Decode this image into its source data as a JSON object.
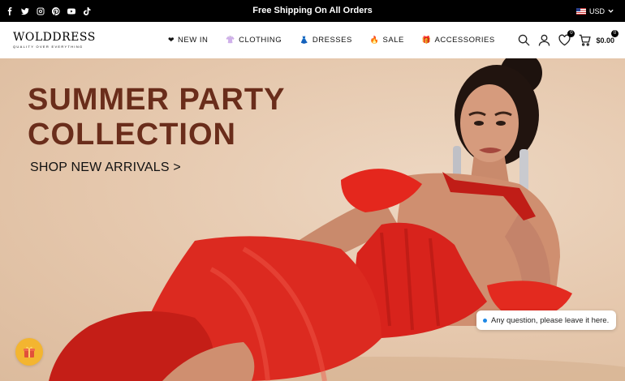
{
  "topbar": {
    "social_icons": [
      "facebook-icon",
      "twitter-icon",
      "instagram-icon",
      "pinterest-icon",
      "youtube-icon",
      "tiktok-icon"
    ],
    "announcement": "Free Shipping On All Orders",
    "currency": "USD",
    "background": "#000000"
  },
  "header": {
    "logo": {
      "name": "WOLDDRESS",
      "tagline": "QUALITY OVER EVERYTHING"
    },
    "nav": [
      {
        "label": "NEW IN",
        "icon": "heart-icon",
        "glyph": "❤"
      },
      {
        "label": "CLOTHING",
        "icon": "tshirt-icon",
        "glyph": "👚"
      },
      {
        "label": "DRESSES",
        "icon": "dress-icon",
        "glyph": "👗"
      },
      {
        "label": "SALE",
        "icon": "fire-icon",
        "glyph": "🔥"
      },
      {
        "label": "ACCESSORIES",
        "icon": "gift-icon",
        "glyph": "🎁"
      }
    ],
    "wishlist_count": "0",
    "cart_count": "0",
    "cart_total": "$0.00"
  },
  "hero": {
    "title_line1": "SUMMER PARTY",
    "title_line2": "COLLECTION",
    "cta": "SHOP NEW ARRIVALS >",
    "title_color": "#6a2d1b",
    "dress_color": "#d8231c"
  },
  "chat": {
    "text": "Any question, please leave it here."
  },
  "gift_button": {
    "icon": "gift-icon",
    "color": "#f3b530"
  }
}
